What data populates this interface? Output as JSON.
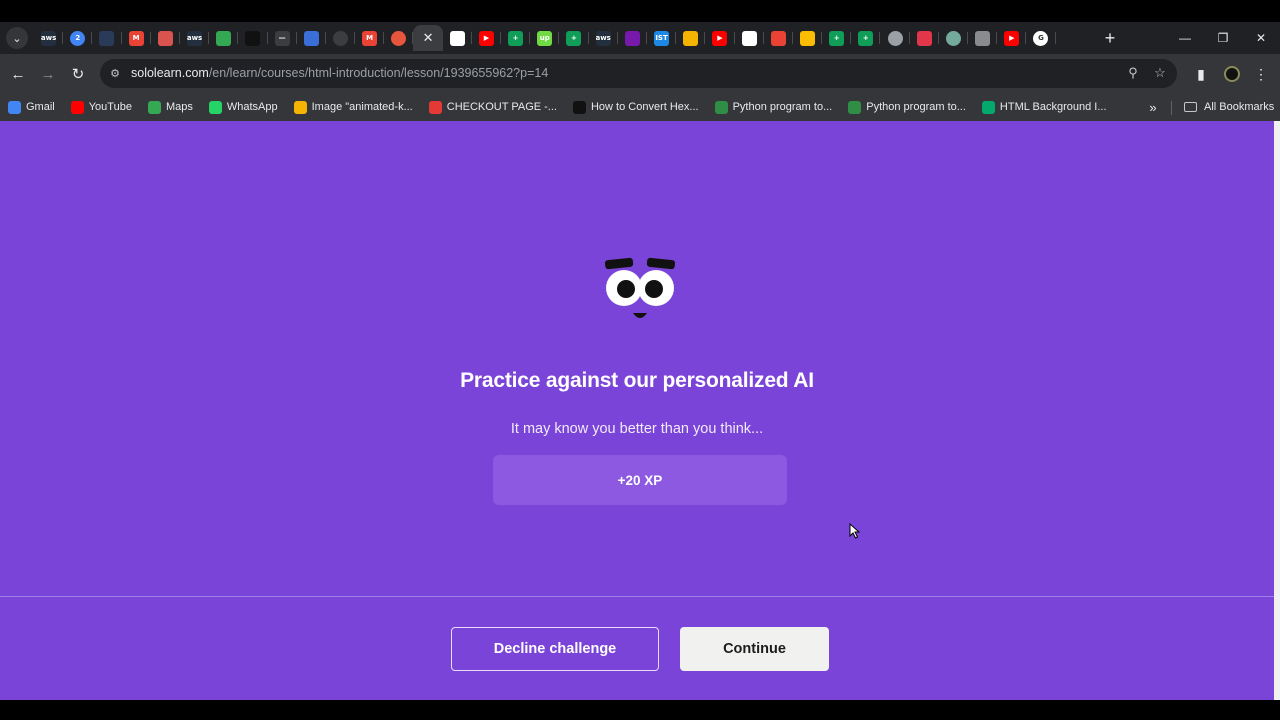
{
  "browser": {
    "tabs": [
      {
        "icon": "aws-icon",
        "text": "aws",
        "color": "#232f3e"
      },
      {
        "icon": "chrome-badge-icon",
        "text": "2",
        "color": "#4285f4"
      },
      {
        "icon": "meet-icon",
        "text": "",
        "color": "#2a3b5a"
      },
      {
        "icon": "gmail-icon",
        "text": "M",
        "color": "#ea4335"
      },
      {
        "icon": "photo-icon",
        "text": "",
        "color": "#d9534f"
      },
      {
        "icon": "aws-icon",
        "text": "aws",
        "color": "#232f3e"
      },
      {
        "icon": "drive-icon",
        "text": "",
        "color": "#34a853"
      },
      {
        "icon": "codepen-icon",
        "text": "",
        "color": "#111111"
      },
      {
        "icon": "dash-icon",
        "text": "—",
        "color": "#3c3d41"
      },
      {
        "icon": "pen-icon",
        "text": "",
        "color": "#3b6fd8"
      },
      {
        "icon": "openai-icon",
        "text": "",
        "color": "#3c3d41"
      },
      {
        "icon": "gmail-icon",
        "text": "M",
        "color": "#ea4335"
      },
      {
        "icon": "sololearn-icon",
        "text": "",
        "color": "#e8553f"
      },
      {
        "icon": "close-icon",
        "text": "✕",
        "color": ""
      },
      {
        "icon": "notion-icon",
        "text": "",
        "color": "#ffffff"
      },
      {
        "icon": "youtube-icon",
        "text": "▶",
        "color": "#ff0000"
      },
      {
        "icon": "sheets-icon",
        "text": "+",
        "color": "#0f9d58"
      },
      {
        "icon": "upwork-icon",
        "text": "up",
        "color": "#6fda44"
      },
      {
        "icon": "sheets-icon",
        "text": "+",
        "color": "#0f9d58"
      },
      {
        "icon": "aws-icon",
        "text": "aws",
        "color": "#232f3e"
      },
      {
        "icon": "onenote-icon",
        "text": "",
        "color": "#7719aa"
      },
      {
        "icon": "ist-icon",
        "text": "IST",
        "color": "#1e88e5"
      },
      {
        "icon": "pencil-icon",
        "text": "",
        "color": "#f4b400"
      },
      {
        "icon": "youtube-icon",
        "text": "▶",
        "color": "#ff0000"
      },
      {
        "icon": "doc-icon",
        "text": "",
        "color": "#ffffff"
      },
      {
        "icon": "maps-pin-icon",
        "text": "",
        "color": "#ea4335"
      },
      {
        "icon": "maps-pin-icon",
        "text": "",
        "color": "#fbbc04"
      },
      {
        "icon": "sheets-icon",
        "text": "+",
        "color": "#0f9d58"
      },
      {
        "icon": "sheets-icon",
        "text": "+",
        "color": "#0f9d58"
      },
      {
        "icon": "globe-icon",
        "text": "",
        "color": "#9aa0a6"
      },
      {
        "icon": "bar-icon",
        "text": "",
        "color": "#e2364a"
      },
      {
        "icon": "chatgpt-icon",
        "text": "",
        "color": "#74aa9c"
      },
      {
        "icon": "bars-icon",
        "text": "",
        "color": "#8a8b8f"
      },
      {
        "icon": "youtube-icon",
        "text": "▶",
        "color": "#ff0000"
      },
      {
        "icon": "google-icon",
        "text": "G",
        "color": "#ffffff"
      }
    ],
    "url_host": "sololearn.com",
    "url_path": "/en/learn/courses/html-introduction/lesson/1939655962?p=14",
    "bookmarks": [
      {
        "icon": "docs-icon",
        "label": "Gmail",
        "color": "#4285f4"
      },
      {
        "icon": "youtube-icon",
        "label": "YouTube",
        "color": "#ff0000"
      },
      {
        "icon": "maps-icon",
        "label": "Maps",
        "color": "#34a853"
      },
      {
        "icon": "whatsapp-icon",
        "label": "WhatsApp",
        "color": "#25d366"
      },
      {
        "icon": "star-icon",
        "label": "Image \"animated-k...",
        "color": "#f4b400"
      },
      {
        "icon": "lips-icon",
        "label": "CHECKOUT PAGE -...",
        "color": "#e53935"
      },
      {
        "icon": "alpha-icon",
        "label": "How to Convert Hex...",
        "color": "#111111"
      },
      {
        "icon": "gfg-icon",
        "label": "Python program to...",
        "color": "#2f8d46"
      },
      {
        "icon": "gfg-icon",
        "label": "Python program to...",
        "color": "#2f8d46"
      },
      {
        "icon": "w3-icon",
        "label": "HTML Background I...",
        "color": "#04aa6d"
      }
    ],
    "all_bookmarks": "All Bookmarks"
  },
  "lesson": {
    "title": "Practice against our personalized AI",
    "subtitle": "It may know you better than you think...",
    "xp": "+20 XP",
    "decline_label": "Decline challenge",
    "continue_label": "Continue"
  },
  "colors": {
    "page_bg": "#7b44d8",
    "xp_bg": "#8c59e0",
    "continue_bg": "#f1f1ef"
  }
}
